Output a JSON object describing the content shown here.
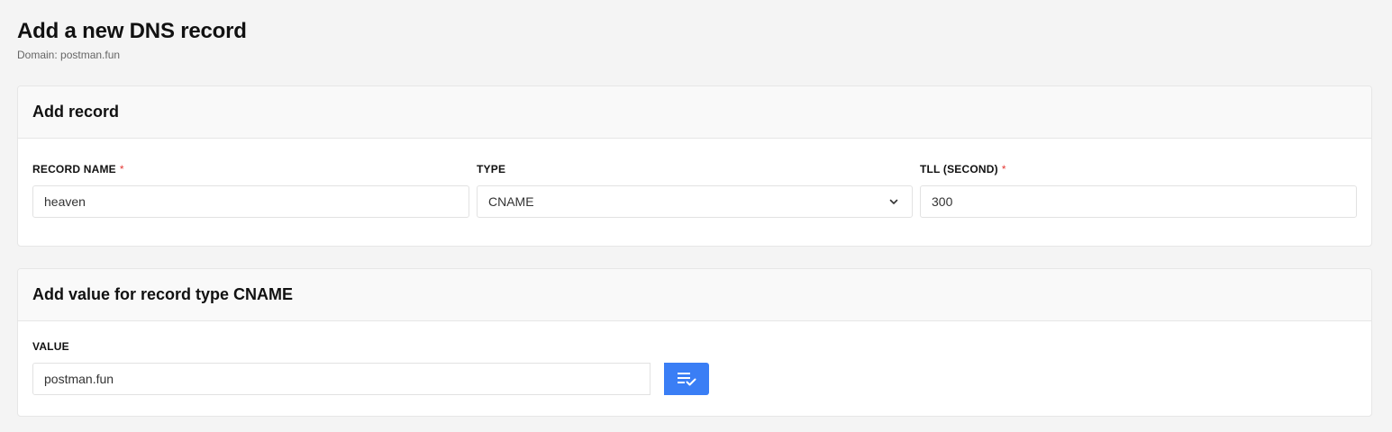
{
  "header": {
    "title": "Add a new DNS record",
    "subtitle": "Domain: postman.fun"
  },
  "record_card": {
    "title": "Add record",
    "fields": {
      "record_name": {
        "label": "RECORD NAME",
        "required_mark": "*",
        "value": "heaven"
      },
      "type": {
        "label": "TYPE",
        "selected": "CNAME"
      },
      "ttl": {
        "label": "TLL (SECOND)",
        "required_mark": "*",
        "value": "300"
      }
    }
  },
  "value_card": {
    "title": "Add value for record type CNAME",
    "field": {
      "label": "VALUE",
      "value": "postman.fun"
    },
    "apply_button_icon": "playlist-check-icon"
  },
  "colors": {
    "accent": "#3a7ef5",
    "required": "#e53935",
    "background": "#f4f4f4"
  }
}
